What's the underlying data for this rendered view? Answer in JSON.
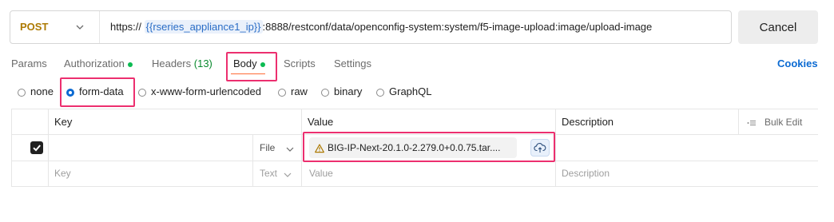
{
  "request": {
    "method": "POST",
    "url_prefix": "https://",
    "url_variable": "{{rseries_appliance1_ip}}",
    "url_suffix": ":8888/restconf/data/openconfig-system:system/f5-image-upload:image/upload-image",
    "cancel_label": "Cancel"
  },
  "tabs": [
    {
      "label": "Params"
    },
    {
      "label": "Authorization"
    },
    {
      "label": "Headers",
      "count": "(13)"
    },
    {
      "label": "Body",
      "active": true
    },
    {
      "label": "Scripts"
    },
    {
      "label": "Settings"
    }
  ],
  "cookies_label": "Cookies",
  "body_types": [
    "none",
    "form-data",
    "x-www-form-urlencoded",
    "raw",
    "binary",
    "GraphQL"
  ],
  "selected_body_type": "form-data",
  "table": {
    "headers": {
      "key": "Key",
      "value": "Value",
      "description": "Description",
      "bulk_edit": "Bulk Edit"
    },
    "rows": [
      {
        "checked": true,
        "key": "",
        "type": "File",
        "value": "BIG-IP-Next-20.1.0-2.279.0+0.0.75.tar....",
        "description": ""
      }
    ],
    "placeholder_row": {
      "key": "Key",
      "type": "Text",
      "value": "Value",
      "description": "Description"
    }
  },
  "colors": {
    "accent": "#0b6ad2",
    "highlight": "#ec2f6f",
    "method": "#ad7a03",
    "active_tab_underline": "#ff6c37",
    "dot": "#0cbb52"
  }
}
